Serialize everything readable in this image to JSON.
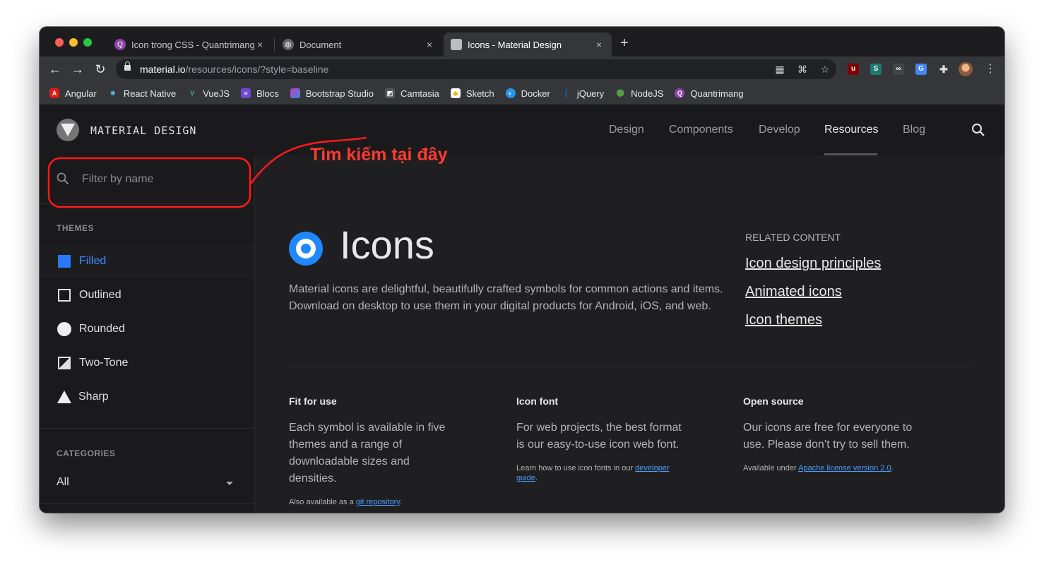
{
  "browser": {
    "tabs": [
      {
        "title": "Icon trong CSS - Quantrimang.",
        "favicon_color": "#8e44ad"
      },
      {
        "title": "Document",
        "favicon_color": "#666666"
      },
      {
        "title": "Icons - Material Design",
        "favicon_color": "#9e9e9e"
      }
    ],
    "tab_close": "×",
    "new_tab": "+",
    "url_host": "material.io",
    "url_path": "/resources/icons/?style=baseline",
    "bookmarks": [
      {
        "label": "Angular",
        "color": "#dd1b16",
        "glyph": "A"
      },
      {
        "label": "React Native",
        "color": "#61dafb",
        "glyph": "⚛"
      },
      {
        "label": "VueJS",
        "color": "#41b883",
        "glyph": "V"
      },
      {
        "label": "Blocs",
        "color": "#6c4bd1",
        "glyph": "≡"
      },
      {
        "label": "Bootstrap Studio",
        "color": "#c13bc7",
        "glyph": "■"
      },
      {
        "label": "Camtasia",
        "color": "#555555",
        "glyph": "◩"
      },
      {
        "label": "Sketch",
        "color": "#f7b500",
        "glyph": "◆"
      },
      {
        "label": "Docker",
        "color": "#2496ed",
        "glyph": "◐"
      },
      {
        "label": "jQuery",
        "color": "#0769ad",
        "glyph": "("
      },
      {
        "label": "NodeJS",
        "color": "#539e43",
        "glyph": "⬢"
      },
      {
        "label": "Quantrimang",
        "color": "#8e44ad",
        "glyph": "Q"
      }
    ]
  },
  "site": {
    "brand": "MATERIAL DESIGN",
    "nav": [
      "Design",
      "Components",
      "Develop",
      "Resources",
      "Blog"
    ],
    "nav_active": "Resources",
    "filter_placeholder": "Filter by name",
    "themes_label": "THEMES",
    "themes": [
      "Filled",
      "Outlined",
      "Rounded",
      "Two-Tone",
      "Sharp"
    ],
    "categories_label": "CATEGORIES",
    "category_value": "All",
    "title": "Icons",
    "intro": "Material icons are delightful, beautifully crafted symbols for common actions and items. Download on desktop to use them in your digital products for Android, iOS, and web.",
    "related_label": "RELATED CONTENT",
    "related_links": [
      "Icon design principles",
      "Animated icons",
      "Icon themes"
    ],
    "columns": [
      {
        "title": "Fit for use",
        "body": "Each symbol is available in five themes and a range of downloadable sizes and densities.",
        "note_prefix": "Also available as a ",
        "note_link": "git repository",
        "note_suffix": "."
      },
      {
        "title": "Icon font",
        "body": "For web projects, the best format is our easy-to-use icon web font.",
        "note_prefix": "Learn how to use icon fonts in our ",
        "note_link": "developer guide",
        "note_suffix": "."
      },
      {
        "title": "Open source",
        "body": "Our icons are free for everyone to use. Please don’t try to sell them.",
        "note_prefix": "Available under ",
        "note_link": "Apache license version 2.0",
        "note_suffix": "."
      }
    ],
    "accent_color": "#2979ff"
  },
  "annotation": {
    "text": "Tìm kiếm tại đây",
    "color": "#ff3b30"
  }
}
